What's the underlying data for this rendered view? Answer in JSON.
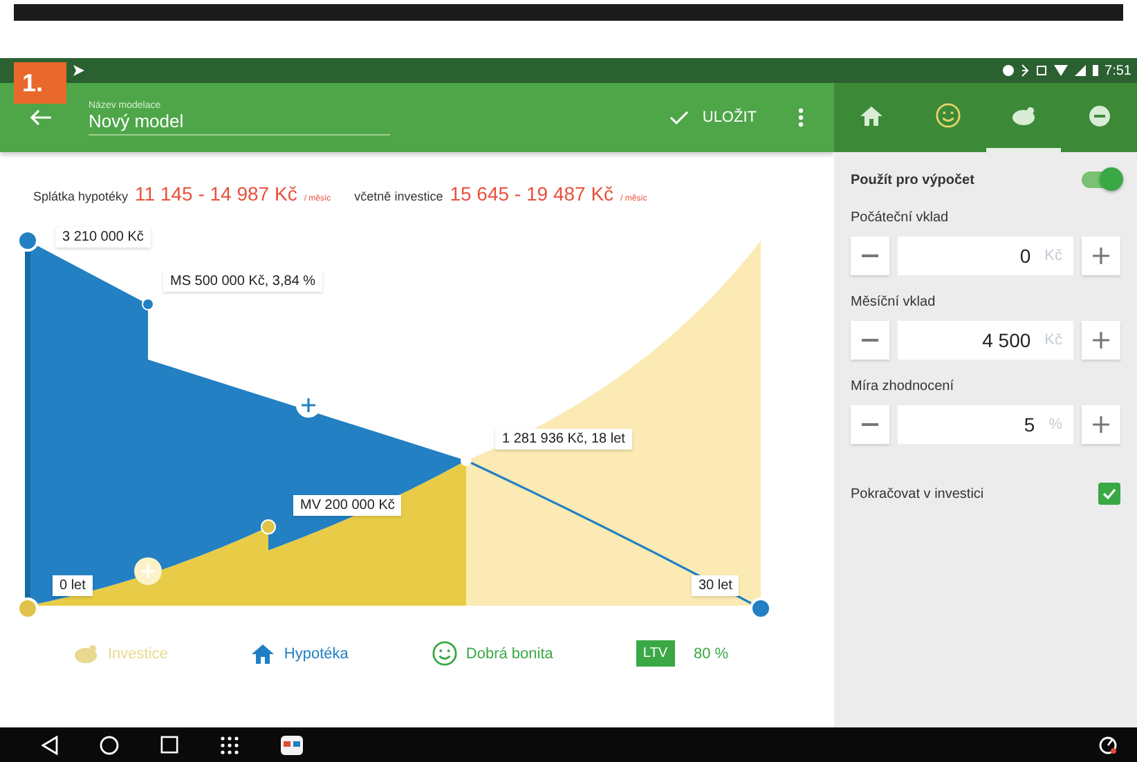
{
  "badge": "1.",
  "status_bar": {
    "time": "7:51"
  },
  "toolbar": {
    "field_label": "Název modelace",
    "field_value": "Nový model",
    "save": "ULOŽIT"
  },
  "tabs": [
    {
      "kind": "home",
      "selected": false
    },
    {
      "kind": "smiley",
      "selected": false
    },
    {
      "kind": "piggy",
      "selected": true
    },
    {
      "kind": "minus",
      "selected": false
    }
  ],
  "summary": [
    {
      "label": "Splátka hypotéky",
      "value": "11 145 - 14 987 Kč",
      "unit": "/ měsíc"
    },
    {
      "label": "včetně investice",
      "value": "15 645 - 19 487 Kč",
      "unit": "/ měsíc"
    }
  ],
  "chart": {
    "callouts": [
      "3 210 000 Kč",
      "MS 500 000 Kč, 3,84 %",
      "1 281 936 Kč, 18 let",
      "MV 200 000 Kč",
      "0 let",
      "30 let"
    ]
  },
  "legend": [
    {
      "kind": "piggy",
      "label": "Investice",
      "color": "#e8d98e"
    },
    {
      "kind": "home",
      "label": "Hypotéka",
      "color": "#1e7fc4"
    },
    {
      "kind": "smiley",
      "label": "Dobrá bonita",
      "color": "#3aa845"
    },
    {
      "kind": "badge",
      "badge": "LTV",
      "label": "80 %",
      "color": "#3aa845"
    }
  ],
  "settings": {
    "use_label": "Použít pro výpočet",
    "use_on": true,
    "fields": [
      {
        "label": "Počáteční vklad",
        "value": "0",
        "unit": "Kč"
      },
      {
        "label": "Měsíční vklad",
        "value": "4 500",
        "unit": "Kč"
      },
      {
        "label": "Míra zhodnocení",
        "value": "5",
        "unit": "%"
      }
    ],
    "continue_label": "Pokračovat v investici",
    "continue_checked": true
  }
}
